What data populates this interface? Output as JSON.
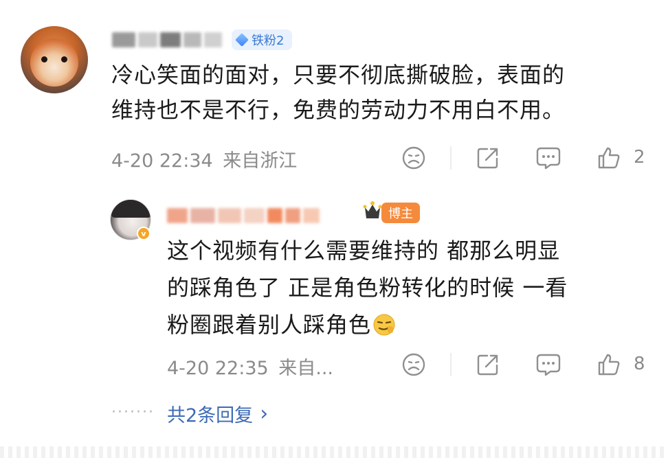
{
  "comment": {
    "badge_fan": "铁粉2",
    "text": "冷心笑面的面对，只要不彻底撕破脸，表面的维持也不是不行，免费的劳动力不用白不用。",
    "line1": "冷心笑面的面对，只要不彻底撕破脸，表面的",
    "line2": "维持也不是不行，免费的劳动力不用白不用。",
    "time": "4-20 22:34",
    "location": "来自浙江",
    "like_count": "2"
  },
  "reply": {
    "badge_host": "博主",
    "line1": "这个视频有什么需要维持的 都那么明显",
    "line2": "的踩角色了 正是角色粉转化的时候 一看",
    "line3": "粉圈跟着别人踩角色",
    "time": "4-20 22:35",
    "location": "来自...",
    "like_count": "8"
  },
  "more_replies": {
    "dots": "·······",
    "label": "共2条回复",
    "chevron": "›"
  },
  "icons": {
    "dislike": "frown-face-icon",
    "share": "share-icon",
    "reply": "comment-icon",
    "like": "thumbs-up-icon"
  },
  "colors": {
    "link": "#3d6ab5",
    "meta": "#8a8a8a",
    "fan_badge_bg": "#e8f1fc",
    "host_badge_bg": "#f58a3c"
  }
}
